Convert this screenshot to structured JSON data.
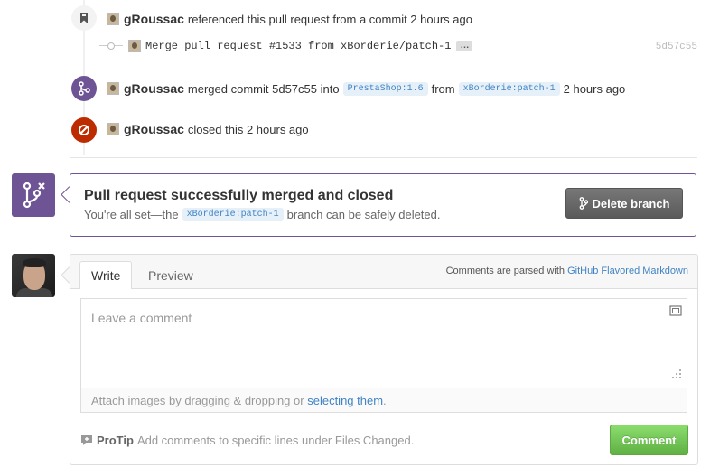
{
  "timeline": {
    "reference_event": {
      "author": "gRoussac",
      "text": "referenced this pull request from a commit 2 hours ago",
      "icon": "bookmark-icon"
    },
    "commit": {
      "message": "Merge pull request #1533 from xBorderie/patch-1",
      "ellipsis": "…",
      "sha": "5d57c55"
    },
    "merge_event": {
      "author": "gRoussac",
      "text_before": "merged commit 5d57c55 into",
      "base_branch": "PrestaShop:1.6",
      "text_from": "from",
      "head_branch": "xBorderie:patch-1",
      "time": "2 hours ago",
      "icon": "git-merge-icon",
      "color": "#6e5494"
    },
    "closed_event": {
      "author": "gRoussac",
      "text": "closed this 2 hours ago",
      "icon": "circle-slash-icon",
      "color": "#bd2c00"
    }
  },
  "merge_status": {
    "title": "Pull request successfully merged and closed",
    "subtitle_before": "You're all set—the",
    "branch": "xBorderie:patch-1",
    "subtitle_after": "branch can be safely deleted.",
    "delete_button": "Delete branch",
    "color": "#6e5494"
  },
  "comment_form": {
    "tabs": [
      "Write",
      "Preview"
    ],
    "active_tab": "Write",
    "markdown_note": "Comments are parsed with",
    "markdown_link": "GitHub Flavored Markdown",
    "placeholder": "Leave a comment",
    "attach_text": "Attach images by dragging & dropping or",
    "attach_link": "selecting them",
    "attach_end": ".",
    "protip_label": "ProTip",
    "protip_text": "Add comments to specific lines under Files Changed.",
    "submit_button": "Comment",
    "submit_color": "#60b044"
  }
}
